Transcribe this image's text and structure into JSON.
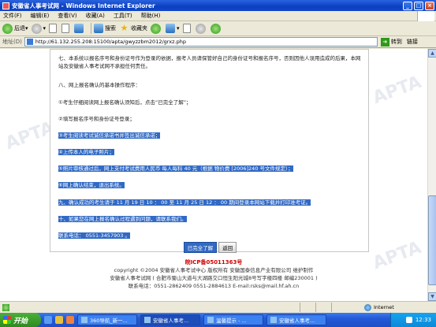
{
  "window": {
    "title": "安徽省人事考试网 - Windows Internet Explorer"
  },
  "menu": [
    "文件(F)",
    "编辑(E)",
    "查看(V)",
    "收藏(A)",
    "工具(T)",
    "帮助(H)"
  ],
  "toolbar": {
    "back": "后退",
    "search": "搜索",
    "favorites": "收藏夹"
  },
  "address": {
    "label": "地址(D)",
    "url": "http://61.132.255.208:15100/apta/gwyzzbm2012/grxz.php",
    "go": "转到",
    "links": "链接"
  },
  "content": {
    "p7": "七、本系统以报名序号和身份证号作为登录的依据，报考人员请保管好自己的身份证号和报名序号，否则因他人误用造成的后果，本网站及安徽省人事考试网不承担任何责任。",
    "p8": "八、网上报名确认的基本操作程序：",
    "s1": "①考生仔细阅读网上报名确认须知后，点击“已完全了解”；",
    "s2": "②填写报名序号和身份证号登录；",
    "s3": "③考生阅读考试诚信承诺书并签出诚信承诺；",
    "s4": "④上传本人的电子照片；",
    "s5": "⑤照片审核通过后，网上支付考试费用人民币 每人每科 40 元（根据 物价费 [2006]240 号文件规定）；",
    "s6": "⑥网上确认结束，退出系统。",
    "p9": "九、确认成功的考生请于 11 月 19 日 10 ： 00 至 11 月 25 日 12 ： 00 期间登录本网站下载并打印准考证。",
    "p10": "十、如果您在网上报名确认过程遇到问题，请联系我们。",
    "tel": "联系电话：  0551-3457903 。",
    "btn_ok": "已完全了解",
    "btn_back": "返回"
  },
  "footer": {
    "icp": "皖ICP备05011363号",
    "copyright": "copyright ©2004 安徽省人事考试中心 版权所有 安徽国泰信息产业有限公司 维护制作",
    "address": "安徽省人事考试网 ( 合肥市蜀山大道与大湖路交口恒生阳光城8号写字楼四楼 邮编230001 )",
    "contact": "联系电话：0551-2862409 0551-2884613 E-mail:rsks@mail.hf.ah.cn"
  },
  "watermark": "APTA",
  "status": {
    "zone": "Internet"
  },
  "taskbar": {
    "start": "开始",
    "tasks": [
      "360导航_新一...",
      "安徽省人事考...",
      "温馨提示 - ...",
      "安徽省人事考..."
    ],
    "clock": "12:33"
  }
}
